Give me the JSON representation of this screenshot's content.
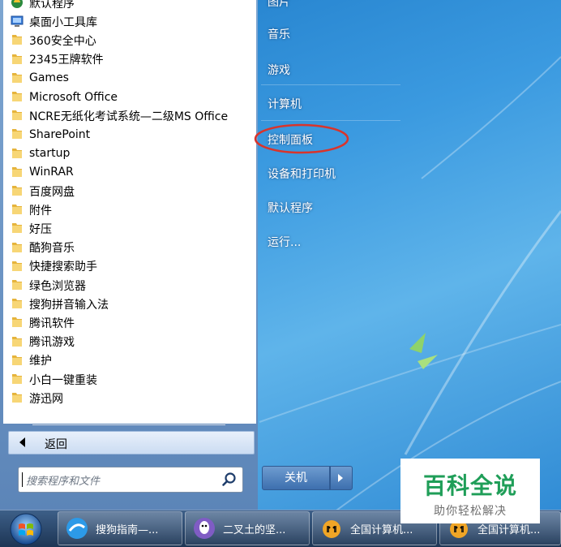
{
  "start_menu": {
    "programs": [
      {
        "label": "默认程序",
        "icon": "default-programs-icon"
      },
      {
        "label": "桌面小工具库",
        "icon": "gadgets-icon"
      },
      {
        "label": "360安全中心",
        "icon": "folder-icon"
      },
      {
        "label": "2345王牌软件",
        "icon": "folder-icon"
      },
      {
        "label": "Games",
        "icon": "folder-icon"
      },
      {
        "label": "Microsoft Office",
        "icon": "folder-icon"
      },
      {
        "label": "NCRE无纸化考试系统—二级MS Office",
        "icon": "folder-icon"
      },
      {
        "label": "SharePoint",
        "icon": "folder-icon"
      },
      {
        "label": "startup",
        "icon": "folder-icon"
      },
      {
        "label": "WinRAR",
        "icon": "folder-icon"
      },
      {
        "label": "百度网盘",
        "icon": "folder-icon"
      },
      {
        "label": "附件",
        "icon": "folder-icon"
      },
      {
        "label": "好压",
        "icon": "folder-icon"
      },
      {
        "label": "酷狗音乐",
        "icon": "folder-icon"
      },
      {
        "label": "快捷搜索助手",
        "icon": "folder-icon"
      },
      {
        "label": "绿色浏览器",
        "icon": "folder-icon"
      },
      {
        "label": "搜狗拼音输入法",
        "icon": "folder-icon"
      },
      {
        "label": "腾讯软件",
        "icon": "folder-icon"
      },
      {
        "label": "腾讯游戏",
        "icon": "folder-icon"
      },
      {
        "label": "维护",
        "icon": "folder-icon"
      },
      {
        "label": "小白一键重装",
        "icon": "folder-icon"
      },
      {
        "label": "游迅网",
        "icon": "folder-icon"
      }
    ],
    "back_label": "返回",
    "search_placeholder": "搜索程序和文件",
    "right_items": [
      {
        "label": "图片"
      },
      {
        "label": "音乐"
      },
      {
        "label": "游戏"
      },
      {
        "label": "计算机"
      },
      {
        "label": "控制面板"
      },
      {
        "label": "设备和打印机"
      },
      {
        "label": "默认程序"
      },
      {
        "label": "运行..."
      }
    ],
    "shutdown_label": "关机",
    "highlight_color": "#d9342b"
  },
  "watermark": {
    "title": "百科全说",
    "subtitle": "助你轻松解决",
    "color": "#1f9e58"
  },
  "taskbar": {
    "buttons": [
      {
        "label": "搜狗指南—...",
        "icon": "sogou-browser-icon"
      },
      {
        "label": "二叉土的坚...",
        "icon": "qq-icon"
      },
      {
        "label": "全国计算机...",
        "icon": "exam-tiger-icon"
      },
      {
        "label": "全国计算机...",
        "icon": "exam-tiger-icon"
      }
    ]
  }
}
